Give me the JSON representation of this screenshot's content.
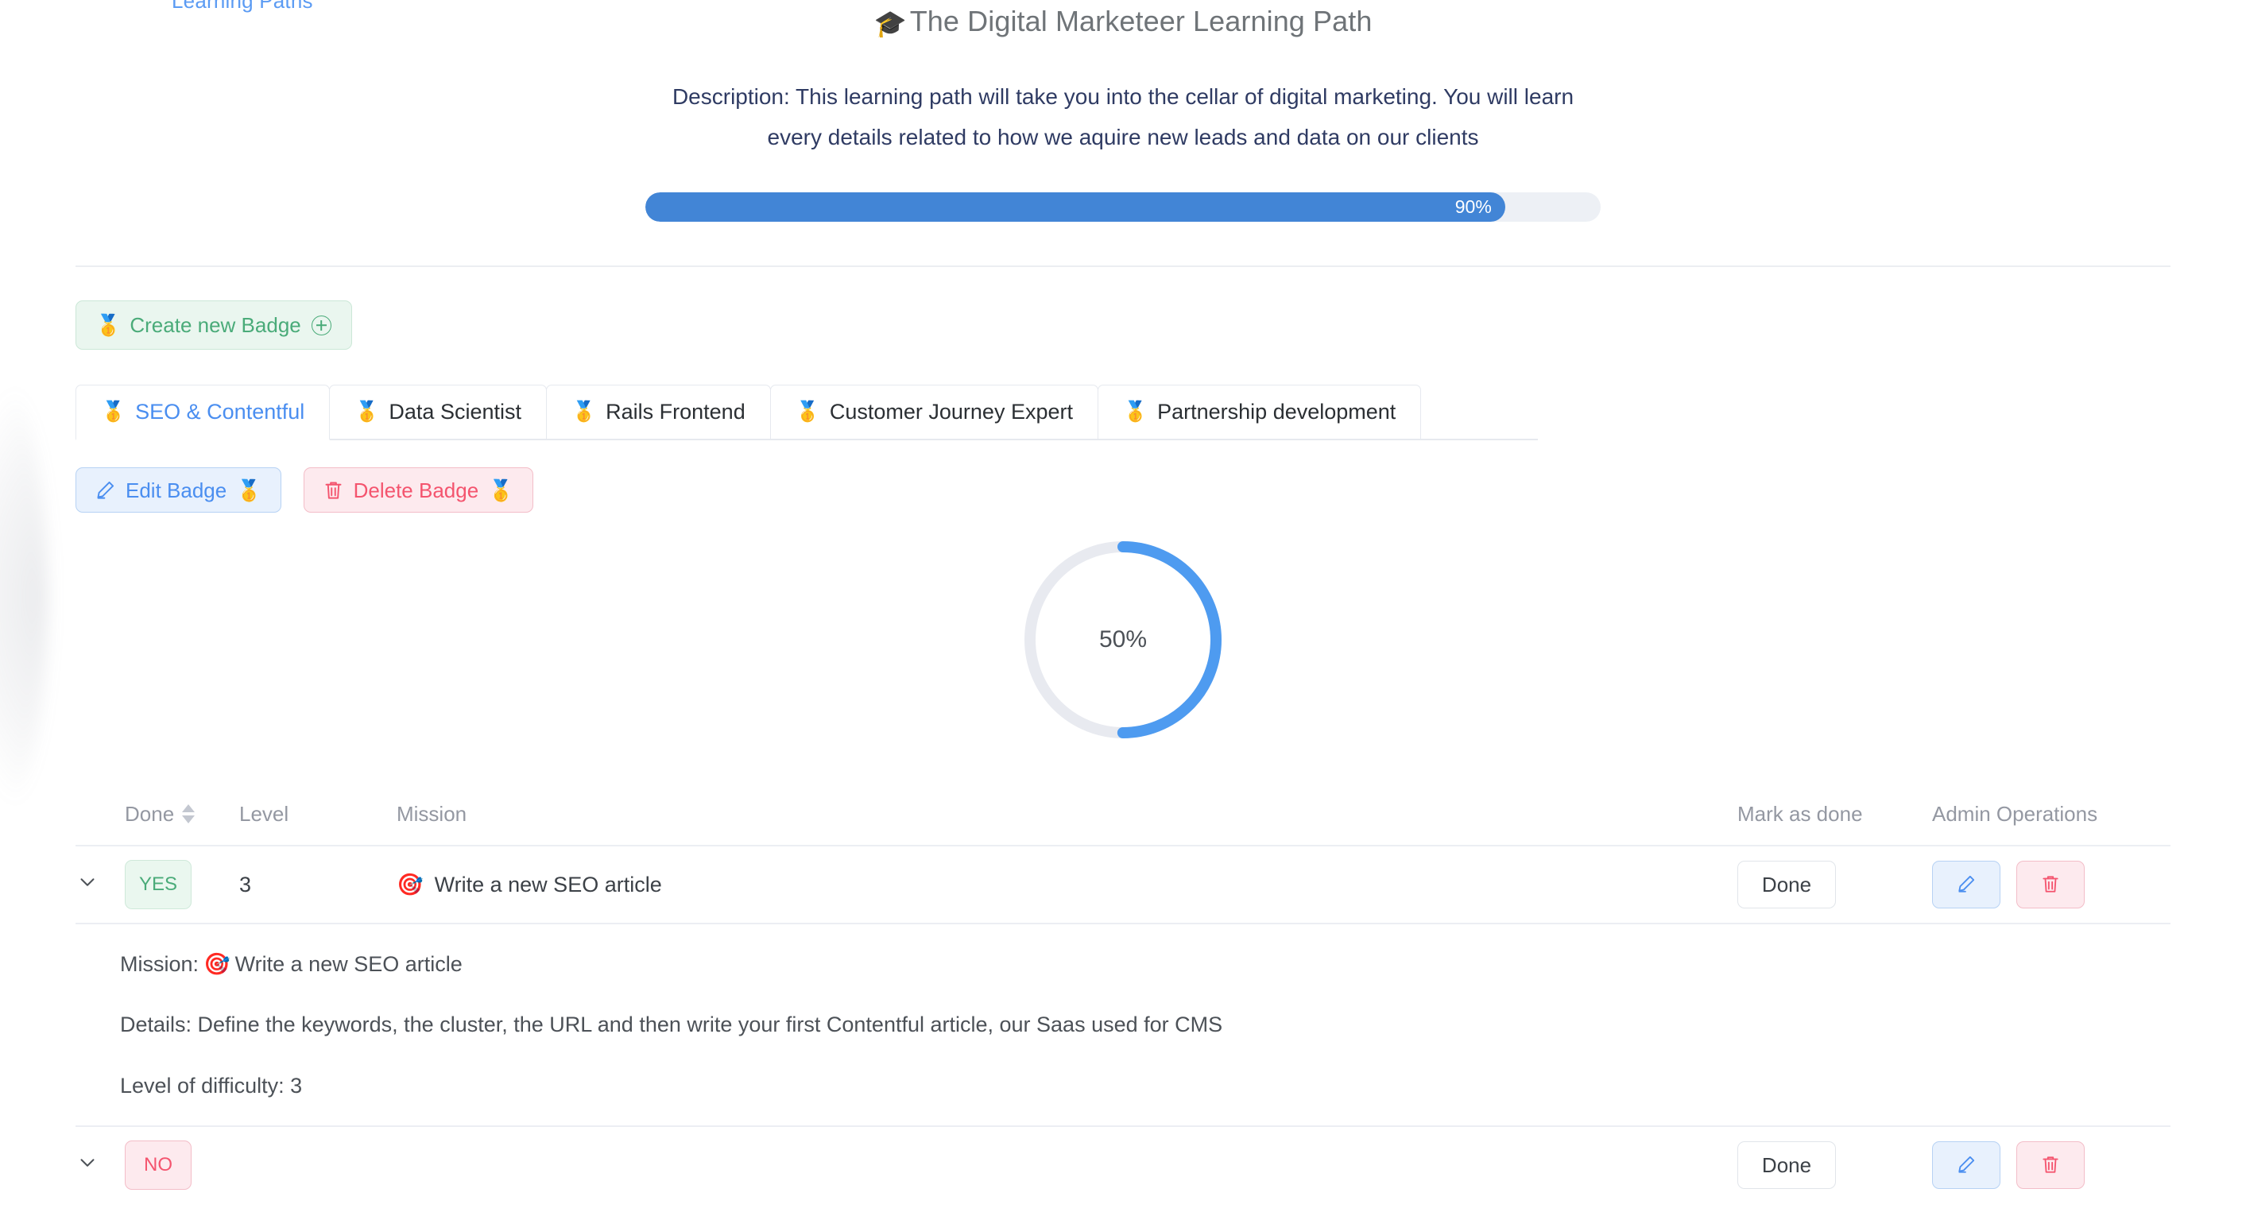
{
  "breadcrumb_sliver": "Learning Paths",
  "header": {
    "cap_icon": "graduation-cap-icon",
    "title": "The Digital Marketeer Learning Path",
    "description": "Description: This learning path will take you into the cellar of digital marketing. You will learn every details related to how we aquire new leads and data on our clients"
  },
  "progress": {
    "percent": 90,
    "label": "90%",
    "fill_color": "#4285d6",
    "track_color": "#edf0f5"
  },
  "create_badge": {
    "medal_icon": "🥇",
    "label": "Create new Badge",
    "plus_icon": "plus-circle-icon",
    "text_color": "#4aab79",
    "bg_color": "#eaf6ef"
  },
  "tabs": [
    {
      "medal": "🥇",
      "label": "SEO & Contentful",
      "active": true
    },
    {
      "medal": "🥇",
      "label": "Data Scientist",
      "active": false
    },
    {
      "medal": "🥇",
      "label": "Rails Frontend",
      "active": false
    },
    {
      "medal": "🥇",
      "label": "Customer Journey Expert",
      "active": false
    },
    {
      "medal": "🥇",
      "label": "Partnership development",
      "active": false
    }
  ],
  "badge_actions": {
    "edit": {
      "icon": "pencil-icon",
      "label": "Edit Badge",
      "medal": "🥇"
    },
    "delete": {
      "icon": "trash-icon",
      "label": "Delete Badge",
      "medal": "🥇"
    }
  },
  "donut": {
    "percent": 50,
    "label": "50%",
    "arc_color": "#4e9bf0",
    "track_color": "#e8eaf0"
  },
  "table": {
    "headers": {
      "done": "Done",
      "level": "Level",
      "mission": "Mission",
      "mark_as_done": "Mark as done",
      "admin_operations": "Admin Operations"
    },
    "rows": [
      {
        "expanded": true,
        "done": "YES",
        "done_state": "yes",
        "level": "3",
        "mission_icon": "🎯",
        "mission": "Write a new SEO article",
        "mark_as_done_label": "Done",
        "detail": {
          "mission_label": "Mission:",
          "mission_icon": "🎯",
          "mission_text": "Write a new SEO article",
          "details": "Details: Define the keywords, the cluster, the URL and then write your first Contentful article, our Saas used for CMS",
          "level_of_difficulty": "Level of difficulty: 3"
        }
      },
      {
        "expanded": false,
        "done": "NO",
        "done_state": "no",
        "level": "",
        "mission_icon": "",
        "mission": "",
        "mark_as_done_label": ""
      }
    ]
  }
}
